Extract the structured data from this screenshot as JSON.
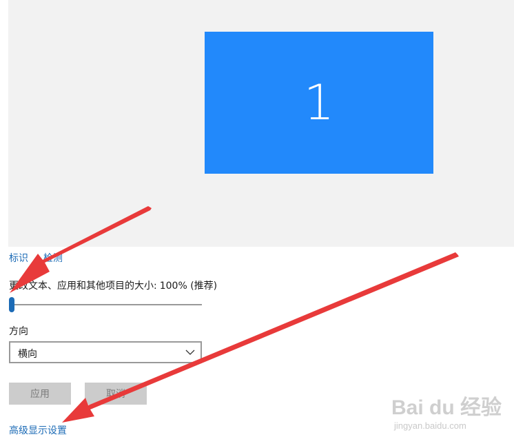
{
  "display": {
    "monitor_number": "1"
  },
  "links": {
    "identify": "标识",
    "detect": "检测"
  },
  "scale": {
    "label": "更改文本、应用和其他项目的大小:",
    "value": "100% (推荐)",
    "slider_level": 0
  },
  "orientation": {
    "label": "方向",
    "selected": "横向"
  },
  "buttons": {
    "apply": "应用",
    "cancel": "取消"
  },
  "advanced_link": "高级显示设置",
  "watermark": {
    "brand": "Bai du 经验",
    "url": "jingyan.baidu.com"
  },
  "colors": {
    "monitor": "#2289fb",
    "preview_bg": "#f2f2f2",
    "link": "#1c6bb6",
    "arrow": "#e83a3a",
    "button_bg": "#cccccc"
  },
  "icons": {
    "select_chevron": "chevron-down-icon"
  }
}
